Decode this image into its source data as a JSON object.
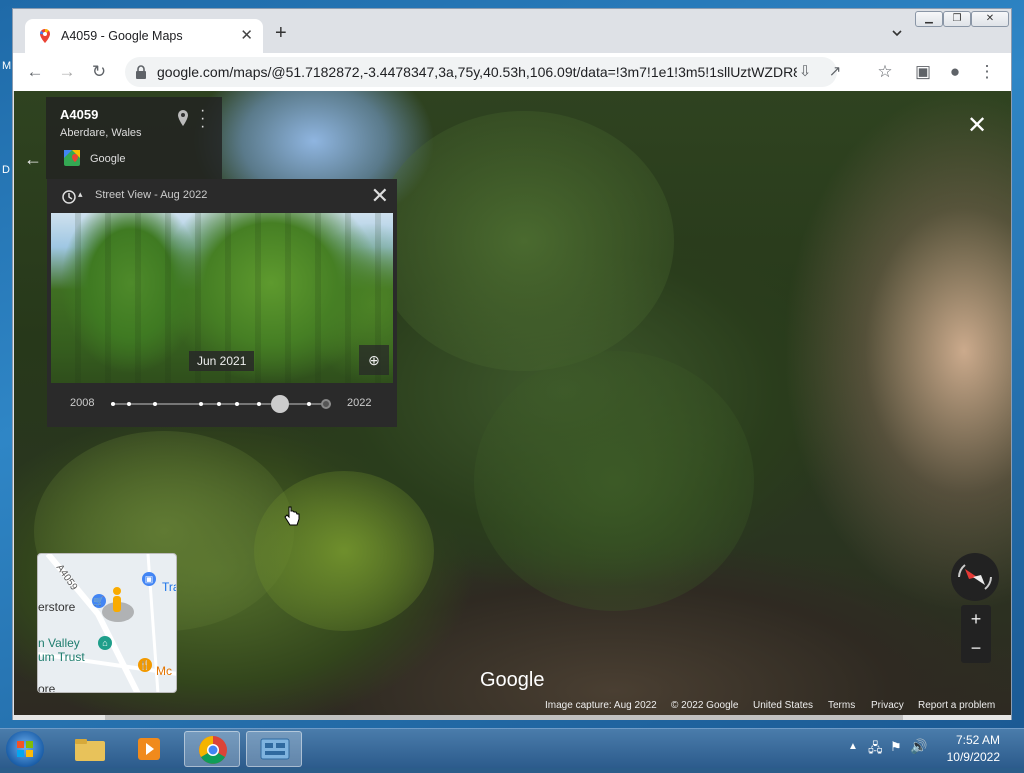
{
  "browser": {
    "tab_title": "A4059 - Google Maps",
    "url": "google.com/maps/@51.7182872,-3.4478347,3a,75y,40.53h,106.09t/data=!3m7!1e1!3m5!1sllUztWZDR8..."
  },
  "streetview": {
    "info": {
      "road": "A4059",
      "place": "Aberdare, Wales",
      "provider": "Google"
    },
    "time_panel": {
      "header": "Street View - Aug 2022",
      "preview_date": "Jun 2021",
      "start_year": "2008",
      "end_year": "2022",
      "selected_position": 0.77
    },
    "minimap": {
      "road_label": "A4059",
      "labels": [
        "erstore",
        "n Valley",
        "um Trust",
        "Mc",
        "Tra",
        "ore"
      ]
    },
    "watermark": "Google",
    "footer": {
      "capture": "Image capture: Aug 2022",
      "copyright": "© 2022 Google",
      "region": "United States",
      "terms": "Terms",
      "privacy": "Privacy",
      "report": "Report a problem"
    }
  },
  "taskbar": {
    "time": "7:52 AM",
    "date": "10/9/2022"
  },
  "colors": {
    "accent_blue": "#1a73e8",
    "panel_dark": "#2a2a2a",
    "compass_red": "#e53935"
  }
}
